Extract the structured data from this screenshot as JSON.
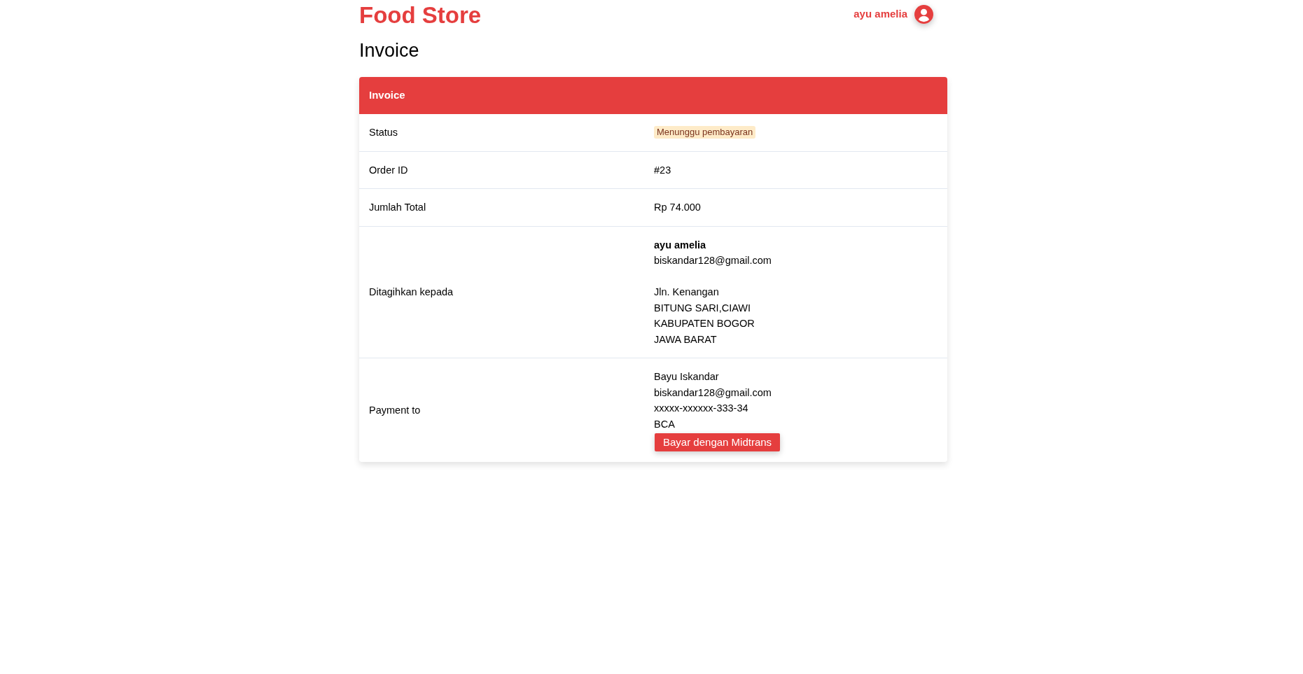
{
  "header": {
    "brand": "Food Store",
    "user": {
      "name": "ayu amelia"
    }
  },
  "page_title": "Invoice",
  "invoice": {
    "title": "Invoice",
    "rows": [
      {
        "kind": "badge",
        "label": "Status",
        "value": "Menunggu pembayaran"
      },
      {
        "kind": "text",
        "label": "Order ID",
        "value": "#23"
      },
      {
        "kind": "text",
        "label": "Jumlah Total",
        "value": "Rp 74.000"
      },
      {
        "kind": "billing",
        "label": "Ditagihkan kepada",
        "name": "ayu amelia",
        "email": "biskandar128@gmail.com",
        "address_lines": [
          "Jln. Kenangan",
          "BITUNG SARI,CIAWI",
          "KABUPATEN BOGOR",
          "JAWA BARAT"
        ]
      },
      {
        "kind": "payment",
        "label": "Payment to",
        "lines": [
          "Bayu Iskandar",
          "biskandar128@gmail.com",
          "xxxxx-xxxxxx-333-34",
          "BCA"
        ],
        "button": "Bayar dengan Midtrans"
      }
    ]
  }
}
